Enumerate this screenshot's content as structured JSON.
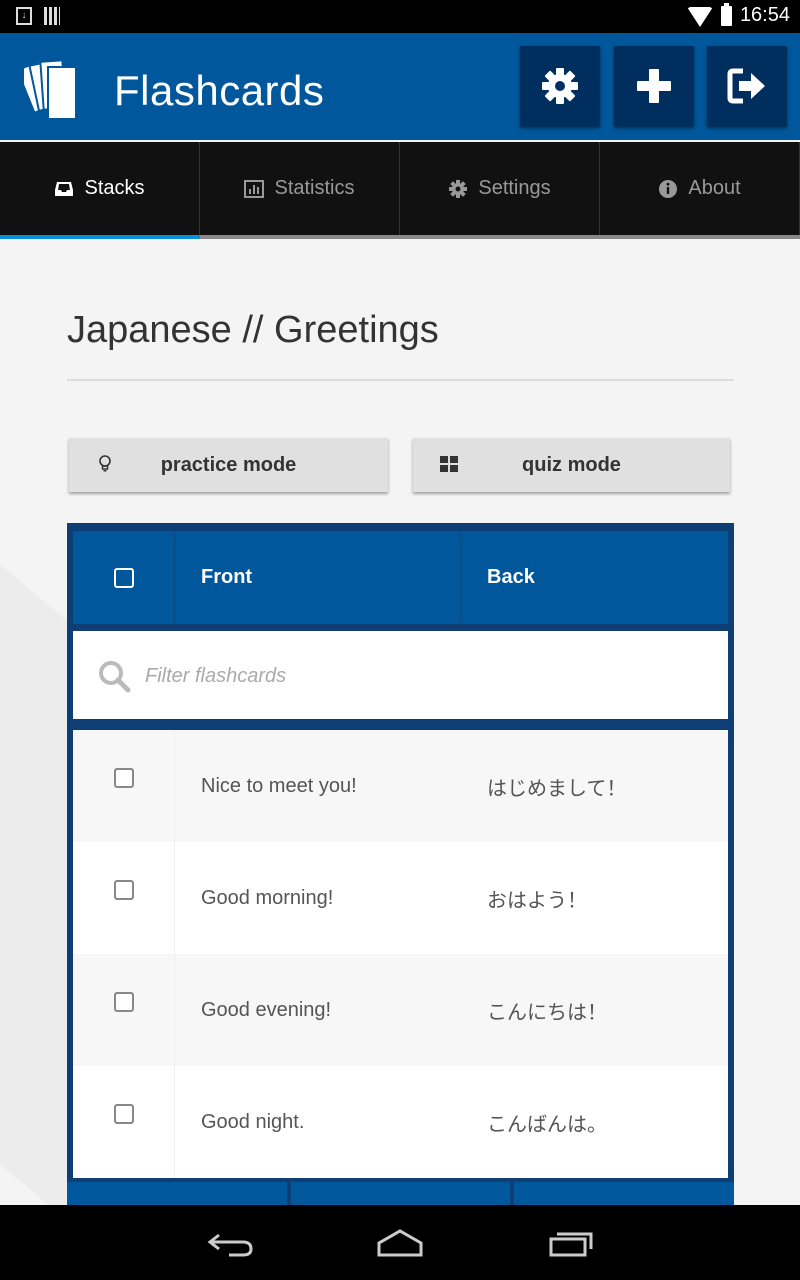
{
  "status_bar": {
    "time": "16:54"
  },
  "app": {
    "title": "Flashcards"
  },
  "top_actions": [
    {
      "name": "settings",
      "icon": "gear-icon"
    },
    {
      "name": "add",
      "icon": "plus-icon"
    },
    {
      "name": "logout",
      "icon": "sign-out-icon"
    }
  ],
  "tabs": [
    {
      "label": "Stacks",
      "icon": "inbox-icon",
      "active": true
    },
    {
      "label": "Statistics",
      "icon": "bar-chart-icon",
      "active": false
    },
    {
      "label": "Settings",
      "icon": "gear-icon",
      "active": false
    },
    {
      "label": "About",
      "icon": "info-icon",
      "active": false
    }
  ],
  "page": {
    "title": "Japanese // Greetings"
  },
  "modes": {
    "practice_label": "practice mode",
    "quiz_label": "quiz mode"
  },
  "table": {
    "headers": {
      "front": "Front",
      "back": "Back"
    },
    "filter_placeholder": "Filter flashcards",
    "rows": [
      {
        "front": "Nice to meet you!",
        "back": "はじめまして！"
      },
      {
        "front": "Good morning!",
        "back": "おはよう！"
      },
      {
        "front": "Good evening!",
        "back": "こんにちは！"
      },
      {
        "front": "Good night.",
        "back": "こんばんは。"
      }
    ]
  },
  "colors": {
    "primary": "#01579b",
    "dark_button": "#002f5f",
    "tab_active_underline": "#0b8fd8",
    "table_border": "#0e3e73"
  }
}
